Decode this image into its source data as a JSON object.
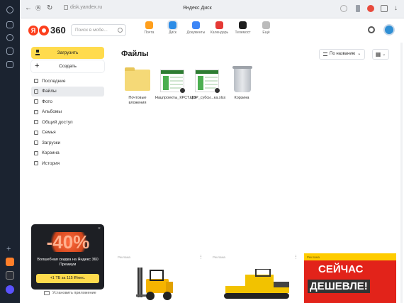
{
  "browser": {
    "url": "disk.yandex.ru",
    "page_title": "Яндекс Диск"
  },
  "header": {
    "logo_text": "360",
    "search_placeholder": "Поиск в мобе...",
    "services": [
      {
        "label": "Почта",
        "icon": "mail-icon",
        "color": "#ff9f1c"
      },
      {
        "label": "Диск",
        "icon": "disk-icon",
        "color": "#2d8ce6"
      },
      {
        "label": "Документы",
        "icon": "documents-icon",
        "color": "#3d86f6"
      },
      {
        "label": "Календарь",
        "icon": "calendar-icon",
        "color": "#e53935"
      },
      {
        "label": "Телемост",
        "icon": "telemost-icon",
        "color": "#1e1e1e"
      },
      {
        "label": "Ещё",
        "icon": "more-icon",
        "color": "#bbbbbb"
      }
    ]
  },
  "sidebar": {
    "upload_label": "Загрузить",
    "create_label": "Создать",
    "items": [
      {
        "label": "Последние",
        "icon": "clock-icon"
      },
      {
        "label": "Файлы",
        "icon": "file-icon"
      },
      {
        "label": "Фото",
        "icon": "photo-icon"
      },
      {
        "label": "Альбомы",
        "icon": "albums-icon"
      },
      {
        "label": "Общий доступ",
        "icon": "shared-icon"
      },
      {
        "label": "Семья",
        "icon": "family-icon"
      },
      {
        "label": "Загрузки",
        "icon": "download-icon"
      },
      {
        "label": "Корзина",
        "icon": "trash-icon"
      },
      {
        "label": "История",
        "icon": "history-icon"
      }
    ],
    "active_item": "Файлы",
    "promo": {
      "discount": "-40%",
      "text": "Волшебная скидка на Яндекс 360 Премиум",
      "button": "+1 ТБ за 115 ₽/мес."
    },
    "install_label": "Установить приложение"
  },
  "main": {
    "title": "Файлы",
    "sort_label": "По названию",
    "files": [
      {
        "name": "Почтовые вложения",
        "type": "folder"
      },
      {
        "name": "Нацпроекты_КРСТ.xlsx",
        "type": "xlsx",
        "shared": true
      },
      {
        "name": "ЦЭР_субси...ка.xlsx",
        "type": "xlsx",
        "shared": true
      },
      {
        "name": "Корзина",
        "type": "trash"
      }
    ],
    "ads": [
      {
        "label": "Реклама"
      },
      {
        "label": "Реклама"
      },
      {
        "label": "Реклама",
        "line1": "СЕЙЧАС",
        "line2": "ДЕШЕВЛЕ!"
      }
    ]
  }
}
